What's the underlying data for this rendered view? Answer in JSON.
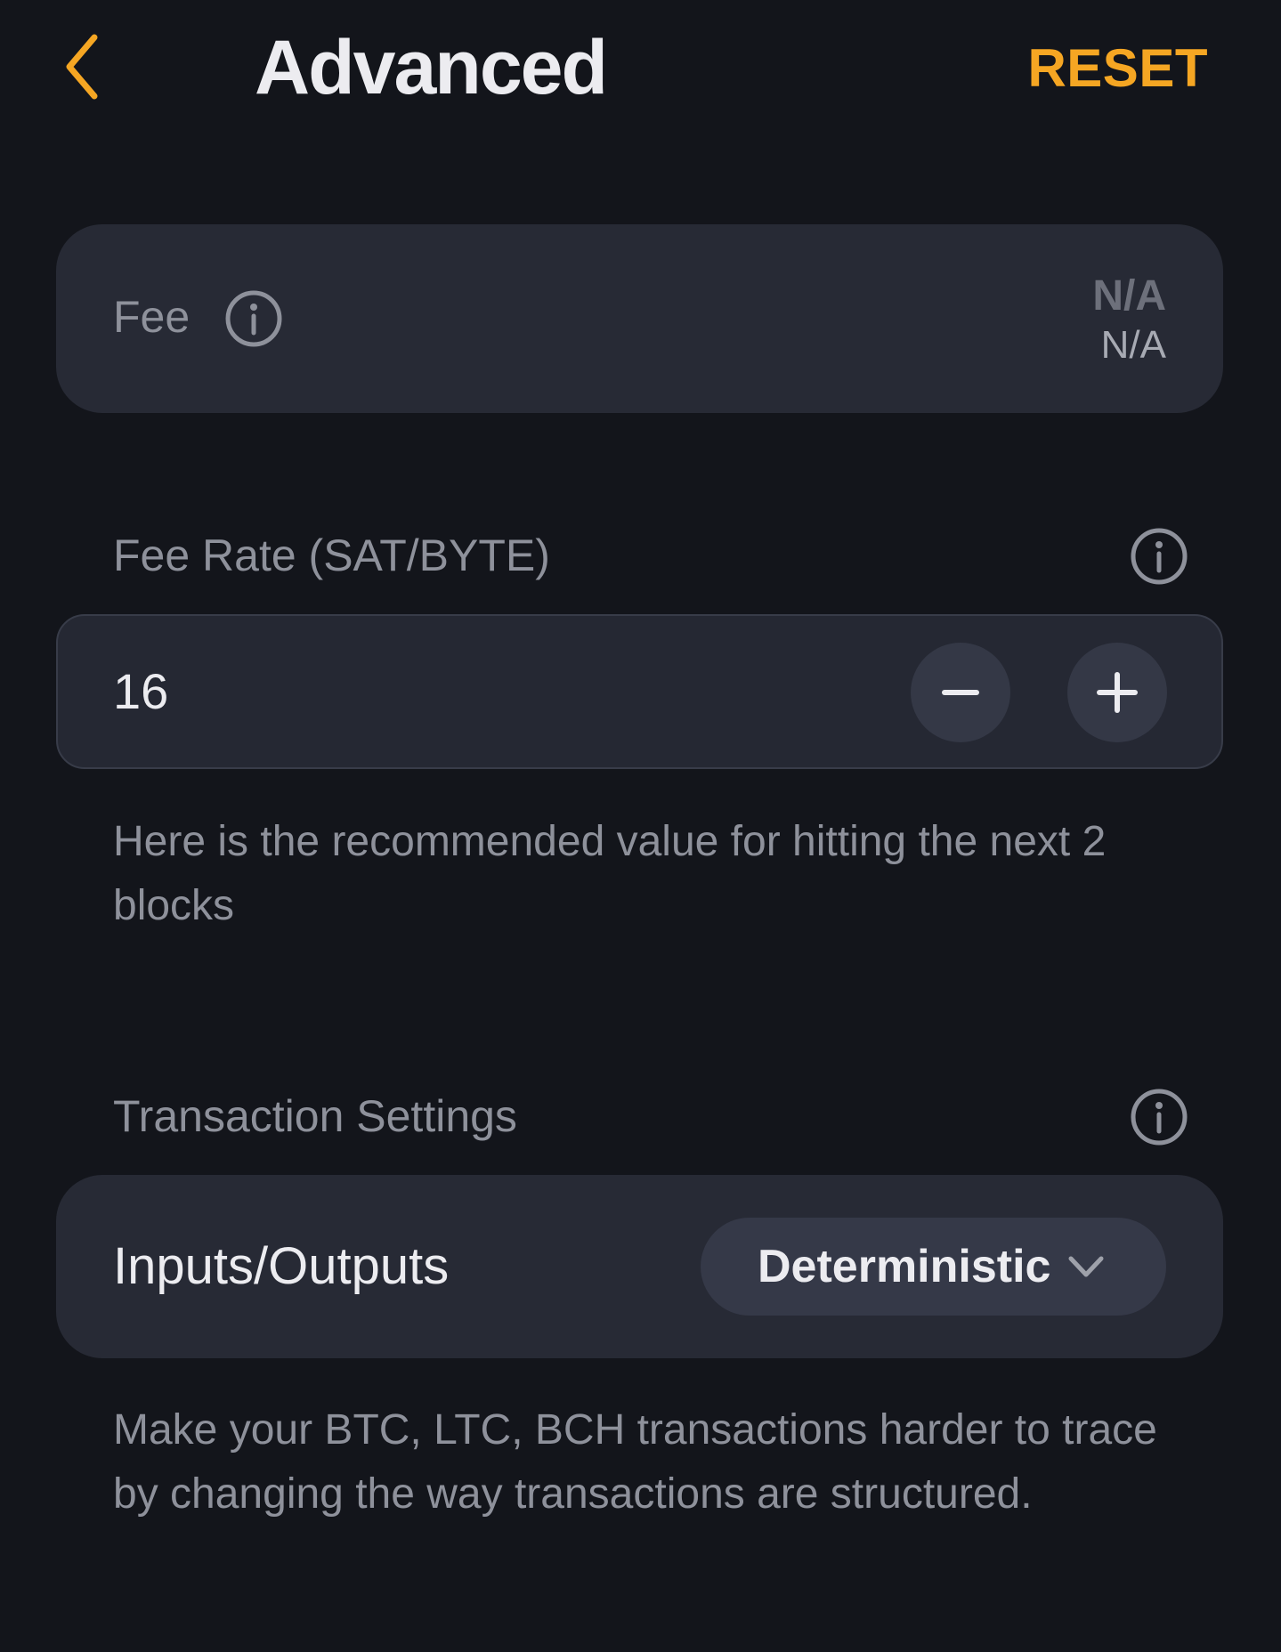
{
  "header": {
    "title": "Advanced",
    "reset_label": "RESET",
    "back_icon": "chevron-left-icon"
  },
  "fee": {
    "label": "Fee",
    "primary_value": "N/A",
    "secondary_value": "N/A",
    "info_icon": "info-icon"
  },
  "fee_rate": {
    "label": "Fee Rate (SAT/BYTE)",
    "value": "16",
    "hint": "Here is the recommended value for hitting the next 2 blocks",
    "minus_icon": "minus-icon",
    "plus_icon": "plus-icon"
  },
  "transaction_settings": {
    "label": "Transaction Settings",
    "row_label": "Inputs/Outputs",
    "selected_option": "Deterministic",
    "hint": "Make your BTC, LTC, BCH transactions harder to trace by changing the way transactions are structured."
  },
  "colors": {
    "background": "#13151b",
    "card": "#272a35",
    "accent": "#f5a623",
    "text_primary": "#ececf0",
    "text_secondary": "#8e919b"
  }
}
